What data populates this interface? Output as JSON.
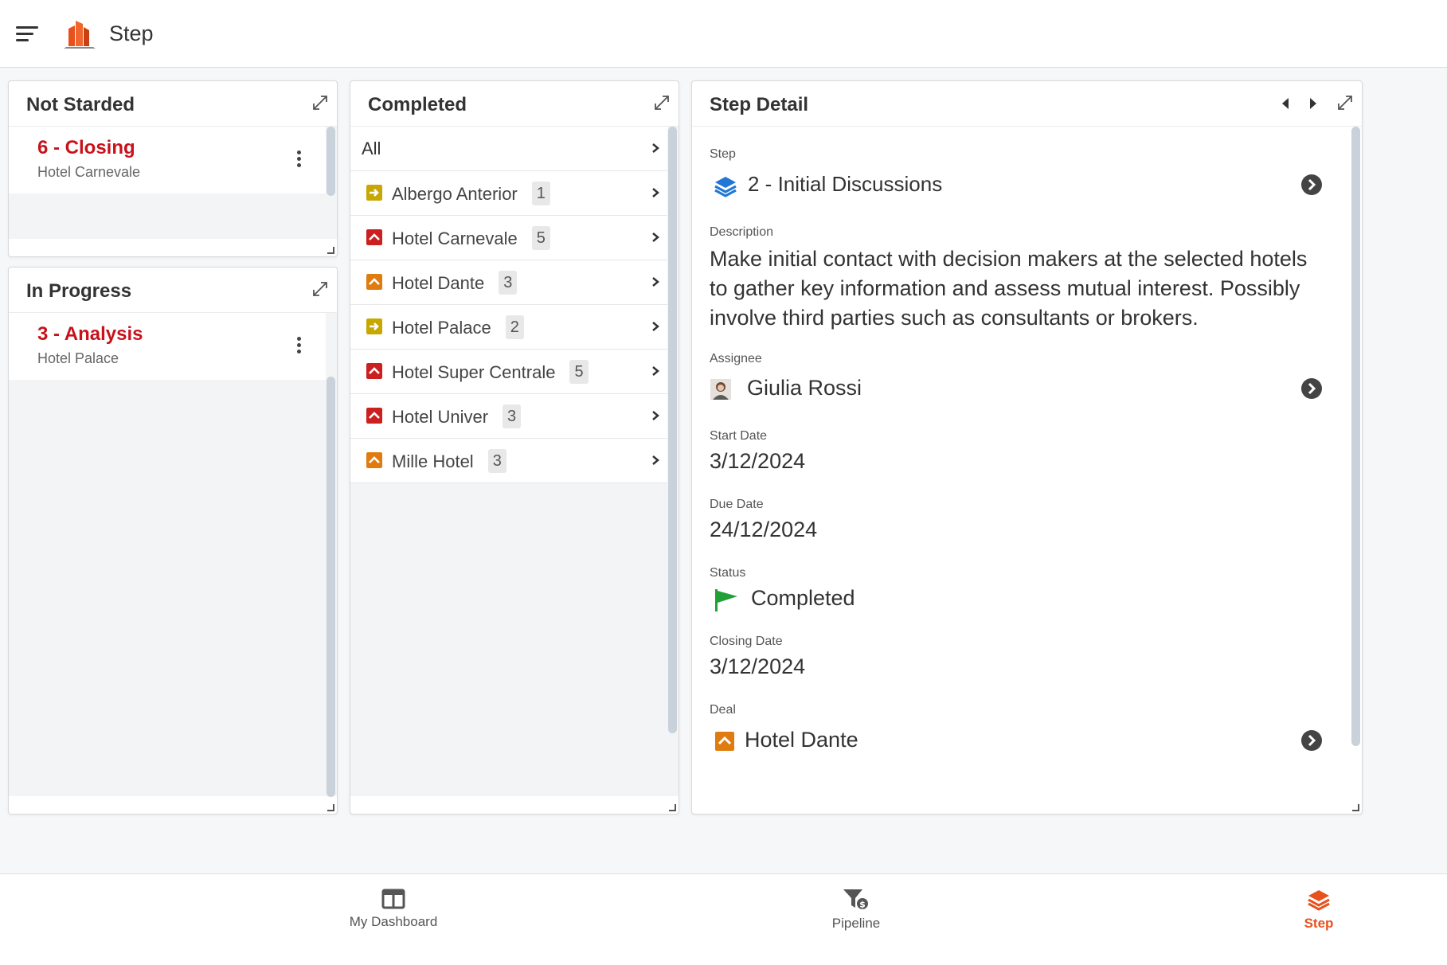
{
  "app": {
    "title": "Step"
  },
  "colors": {
    "accent": "#e8511d",
    "title_red": "#c8121b",
    "status_green": "#21a038",
    "step_blue": "#2177d4",
    "icon_yellow": "#c8a800",
    "icon_red": "#cc1f1f",
    "icon_orange": "#e07b10"
  },
  "panels": {
    "not_started": {
      "title": "Not Starded",
      "cards": [
        {
          "title": "6 - Closing",
          "subtitle": "Hotel Carnevale"
        }
      ]
    },
    "in_progress": {
      "title": "In Progress",
      "cards": [
        {
          "title": "3 - Analysis",
          "subtitle": "Hotel Palace"
        }
      ]
    },
    "completed": {
      "title": "Completed",
      "all_label": "All",
      "rows": [
        {
          "label": "Albergo Anterior",
          "count": "1",
          "icon": "arrow-right-icon",
          "color": "#c8a800"
        },
        {
          "label": "Hotel Carnevale",
          "count": "5",
          "icon": "chevron-up-icon",
          "color": "#cc1f1f"
        },
        {
          "label": "Hotel Dante",
          "count": "3",
          "icon": "chevron-up-icon",
          "color": "#e07b10"
        },
        {
          "label": "Hotel Palace",
          "count": "2",
          "icon": "arrow-right-icon",
          "color": "#c8a800"
        },
        {
          "label": "Hotel Super Centrale",
          "count": "5",
          "icon": "chevron-up-icon",
          "color": "#cc1f1f"
        },
        {
          "label": "Hotel Univer",
          "count": "3",
          "icon": "chevron-up-icon",
          "color": "#cc1f1f"
        },
        {
          "label": "Mille Hotel",
          "count": "3",
          "icon": "chevron-up-icon",
          "color": "#e07b10"
        }
      ]
    },
    "step_detail": {
      "title": "Step Detail",
      "step_label": "Step",
      "step_value": "2 - Initial Discussions",
      "description_label": "Description",
      "description_value": "Make initial contact with decision makers at the selected hotels to gather key information and assess mutual interest. Possibly involve third parties such as consultants or brokers.",
      "assignee_label": "Assignee",
      "assignee_value": "Giulia Rossi",
      "start_date_label": "Start Date",
      "start_date_value": "3/12/2024",
      "due_date_label": "Due Date",
      "due_date_value": "24/12/2024",
      "status_label": "Status",
      "status_value": "Completed",
      "closing_date_label": "Closing Date",
      "closing_date_value": "3/12/2024",
      "deal_label": "Deal",
      "deal_value": "Hotel Dante"
    }
  },
  "bottom_nav": [
    {
      "label": "My Dashboard",
      "icon": "dashboard-icon"
    },
    {
      "label": "Pipeline",
      "icon": "pipeline-funnel-icon"
    },
    {
      "label": "Step",
      "icon": "layers-icon",
      "active": true
    }
  ]
}
